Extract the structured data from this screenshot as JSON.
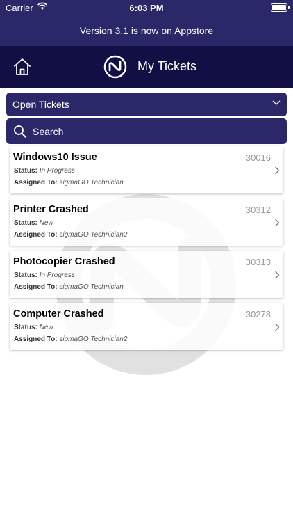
{
  "status_bar": {
    "carrier": "Carrier",
    "time": "6:03 PM"
  },
  "banner": {
    "text": "Version 3.1 is now on Appstore"
  },
  "header": {
    "title": "My Tickets"
  },
  "filter": {
    "selected": "Open Tickets"
  },
  "search": {
    "placeholder": "Search"
  },
  "labels": {
    "status": "Status:",
    "assigned": "Assigned To:"
  },
  "tickets": [
    {
      "title": "Windows10 Issue",
      "id": "30016",
      "status": "In Progress",
      "assigned": "sigmaGO Technician"
    },
    {
      "title": "Printer Crashed",
      "id": "30312",
      "status": "New",
      "assigned": "sigmaGO Technician2"
    },
    {
      "title": "Photocopier Crashed",
      "id": "30313",
      "status": "In Progress",
      "assigned": "sigmaGO Technician"
    },
    {
      "title": "Computer Crashed",
      "id": "30278",
      "status": "New",
      "assigned": "sigmaGO Technician2"
    }
  ],
  "colors": {
    "banner": "#2b2869",
    "header": "#120f45",
    "control": "#2b2869"
  },
  "icons": [
    "wifi-icon",
    "battery-icon",
    "home-icon",
    "logo-icon",
    "chevron-down-icon",
    "search-icon",
    "chevron-right-icon"
  ]
}
